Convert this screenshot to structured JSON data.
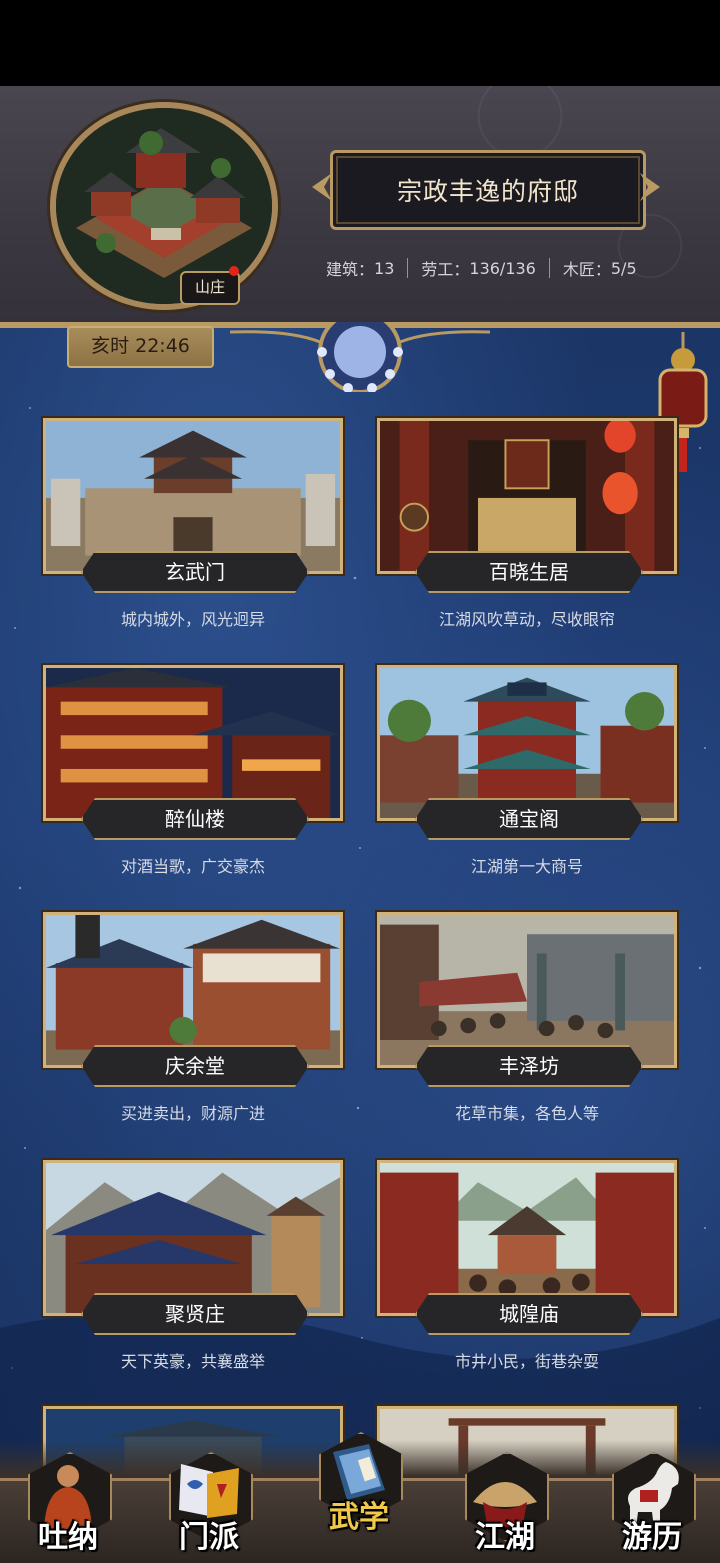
{
  "header": {
    "manor_label": "山庄",
    "title": "宗政丰逸的府邸",
    "stats": [
      {
        "label": "建筑：",
        "value": "13"
      },
      {
        "label": "劳工：",
        "value": "136/136"
      },
      {
        "label": "木匠：",
        "value": "5/5"
      }
    ]
  },
  "time": "亥时 22:46",
  "places": [
    {
      "name": "玄武门",
      "desc": "城内城外，风光迥异"
    },
    {
      "name": "百晓生居",
      "desc": "江湖风吹草动，尽收眼帘"
    },
    {
      "name": "醉仙楼",
      "desc": "对酒当歌，广交豪杰"
    },
    {
      "name": "通宝阁",
      "desc": "江湖第一大商号"
    },
    {
      "name": "庆余堂",
      "desc": "买进卖出，财源广进"
    },
    {
      "name": "丰泽坊",
      "desc": "花草市集，各色人等"
    },
    {
      "name": "聚贤庄",
      "desc": "天下英豪，共襄盛举"
    },
    {
      "name": "城隍庙",
      "desc": "市井小民，街巷杂耍"
    }
  ],
  "nav": [
    {
      "label": "吐纳",
      "icon": "monk-icon"
    },
    {
      "label": "门派",
      "icon": "banners-icon"
    },
    {
      "label": "武学",
      "icon": "scroll-icon",
      "active": true
    },
    {
      "label": "江湖",
      "icon": "straw-hat-icon"
    },
    {
      "label": "游历",
      "icon": "horse-icon"
    }
  ],
  "colors": {
    "gold": "#b99a62",
    "active_nav": "#f0c84a",
    "night_sky": "#1b3566"
  }
}
